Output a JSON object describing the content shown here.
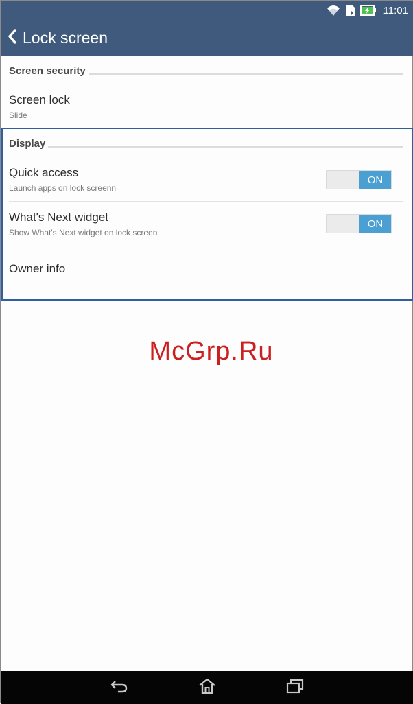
{
  "status_bar": {
    "time": "11:01",
    "icons": [
      "wifi-icon",
      "sim-icon",
      "battery-charging-icon"
    ]
  },
  "action_bar": {
    "title": "Lock screen",
    "back_icon": "chevron-left-icon"
  },
  "sections": {
    "screen_security": {
      "header": "Screen security",
      "screen_lock": {
        "title": "Screen lock",
        "summary": "Slide"
      }
    },
    "display": {
      "header": "Display",
      "quick_access": {
        "title": "Quick access",
        "summary": "Launch apps on lock screenn",
        "toggle": "ON"
      },
      "whats_next": {
        "title": "What's Next widget",
        "summary": "Show What's Next widget on lock screen",
        "toggle": "ON"
      },
      "owner_info": {
        "title": "Owner info"
      }
    }
  },
  "watermark": "McGrp.Ru",
  "navigation": {
    "icons": [
      "back-arrow-icon",
      "home-icon",
      "recent-apps-icon"
    ]
  },
  "colors": {
    "header_bg": "#3f5a7d",
    "toggle_on": "#4a9fd3",
    "highlight_border": "#2f5f9e",
    "watermark": "#cc1f1f"
  }
}
